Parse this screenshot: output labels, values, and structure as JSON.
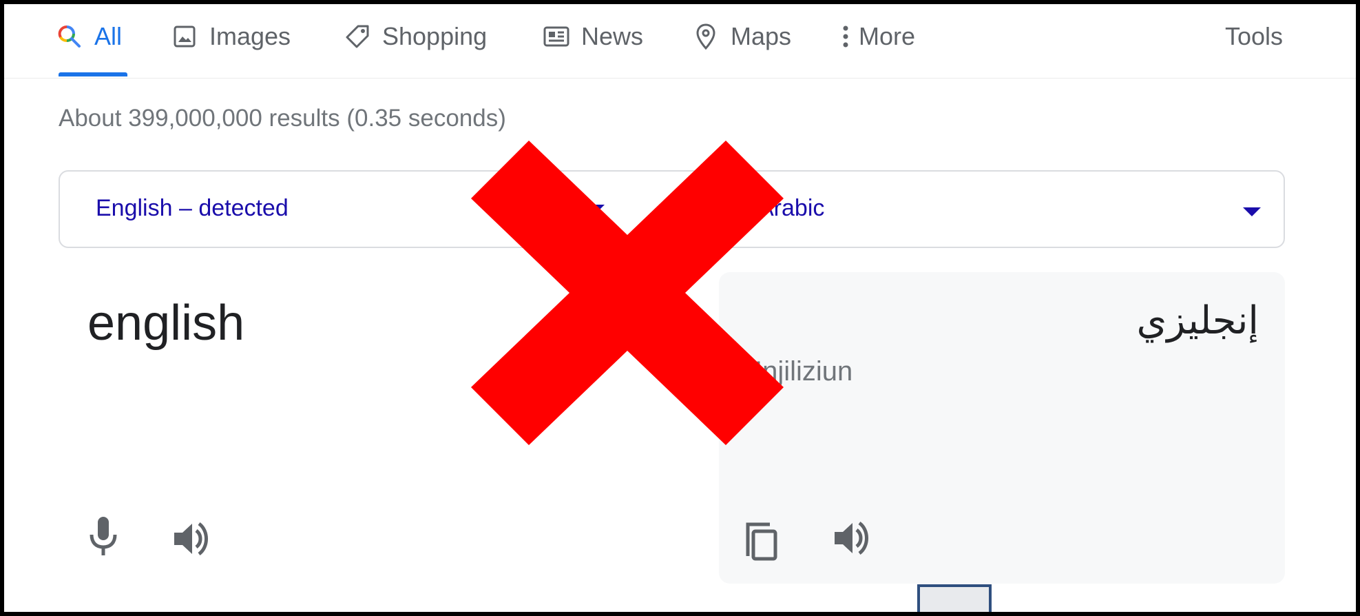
{
  "tabs": [
    {
      "label": "All",
      "icon": "search-icon"
    },
    {
      "label": "Images",
      "icon": "image-icon"
    },
    {
      "label": "Shopping",
      "icon": "tag-icon"
    },
    {
      "label": "News",
      "icon": "news-icon"
    },
    {
      "label": "Maps",
      "icon": "map-pin-icon"
    },
    {
      "label": "More",
      "icon": "more-vertical-icon"
    },
    {
      "label": "Tools"
    }
  ],
  "result_stats": "About 399,000,000 results (0.35 seconds)",
  "translator": {
    "source_language": "English – detected",
    "target_language": "Arabic",
    "source_text": "english",
    "translated_text": "إنجليزي",
    "transliteration": "Injiliziun"
  },
  "colors": {
    "accent": "#1a73e8",
    "link": "#1a0dab",
    "overlay_cross": "#ff0000",
    "panel_bg": "#f7f8f9"
  }
}
